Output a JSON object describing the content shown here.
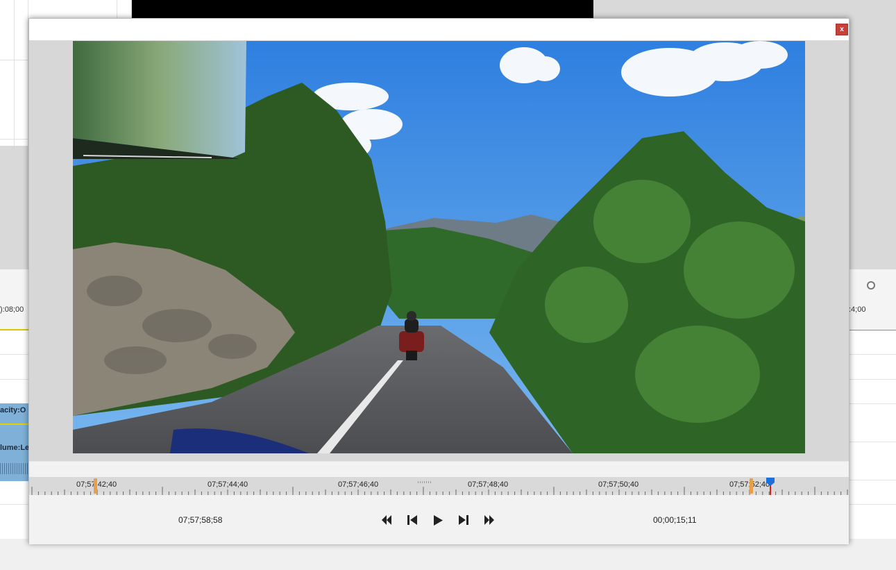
{
  "background_editor": {
    "ruler_left_time": "):08;00",
    "ruler_right_time": ":4;00",
    "clip_opacity_label": "acity:O",
    "clip_volume_label": "lume:Le"
  },
  "dialog": {
    "close_label": "x"
  },
  "timeline": {
    "labels": [
      "07;57;42;40",
      "07;57;44;40",
      "07;57;46;40",
      "07;57;48;40",
      "07;57;50;40",
      "07;57;52;40"
    ],
    "in_marker_color": "#e6a04a",
    "playhead_color": "#1e6fd9"
  },
  "transport": {
    "current_time": "07;57;58;58",
    "duration": "00;00;15;11",
    "buttons": [
      "skip-to-start",
      "step-back",
      "play",
      "step-forward",
      "skip-to-end"
    ]
  }
}
